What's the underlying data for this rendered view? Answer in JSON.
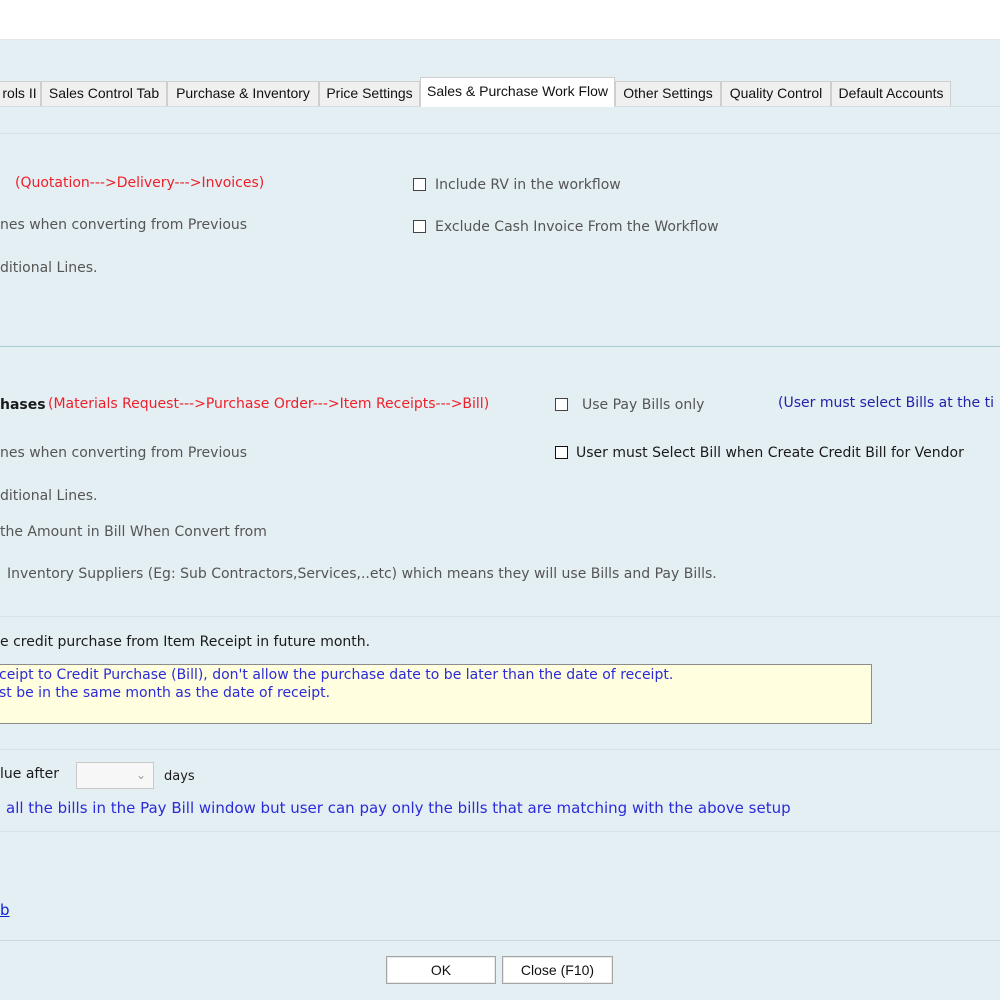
{
  "tabs": [
    {
      "label": "rols II"
    },
    {
      "label": "Sales Control Tab"
    },
    {
      "label": "Purchase & Inventory"
    },
    {
      "label": "Price Settings"
    },
    {
      "label": "Sales & Purchase Work Flow",
      "active": true
    },
    {
      "label": "Other Settings"
    },
    {
      "label": "Quality Control"
    },
    {
      "label": "Default Accounts"
    }
  ],
  "sales": {
    "workflow_hint": "(Quotation--->Delivery--->Invoices)",
    "line1": "nes when converting from Previous",
    "line2": "ditional Lines.",
    "include_rv": {
      "label": "Include RV in the workflow",
      "checked": false
    },
    "exclude_cash": {
      "label": "Exclude Cash Invoice From the Workflow",
      "checked": false
    }
  },
  "purchases": {
    "heading": "hases",
    "workflow_hint": "(Materials Request--->Purchase Order--->Item Receipts--->Bill)",
    "use_pay_bills": {
      "label": "Use Pay Bills only",
      "checked": false
    },
    "user_must_select_note": "(User must select Bills at the ti",
    "line1": "nes when converting from Previous",
    "select_bill": {
      "label": "User must Select Bill when Create Credit Bill for Vendor",
      "checked": false
    },
    "line2": "ditional Lines.",
    "line3": "the Amount in Bill When Convert from",
    "line4": "Inventory Suppliers (Eg: Sub Contractors,Services,..etc) which means they will use Bills and Pay Bills."
  },
  "credit_purchase": {
    "label": "e credit purchase from Item Receipt in future month.",
    "note_line1": "ceipt to Credit Purchase (Bill), don't allow the purchase date to be later than the date of receipt.",
    "note_line2": "st be in the same month as the date of receipt."
  },
  "due": {
    "label": "lue after",
    "days_value": "",
    "days_label": "days",
    "note": "all the bills in the Pay Bill window but user can pay only the bills that are matching with the above setup"
  },
  "link_fragment": "b",
  "buttons": {
    "ok": "OK",
    "close": "Close (F10)"
  },
  "colors": {
    "background": "#e4eff3",
    "hint_red": "#ee1f2a",
    "note_blue": "#2b2bd8",
    "note_bg": "#ffffe0"
  }
}
